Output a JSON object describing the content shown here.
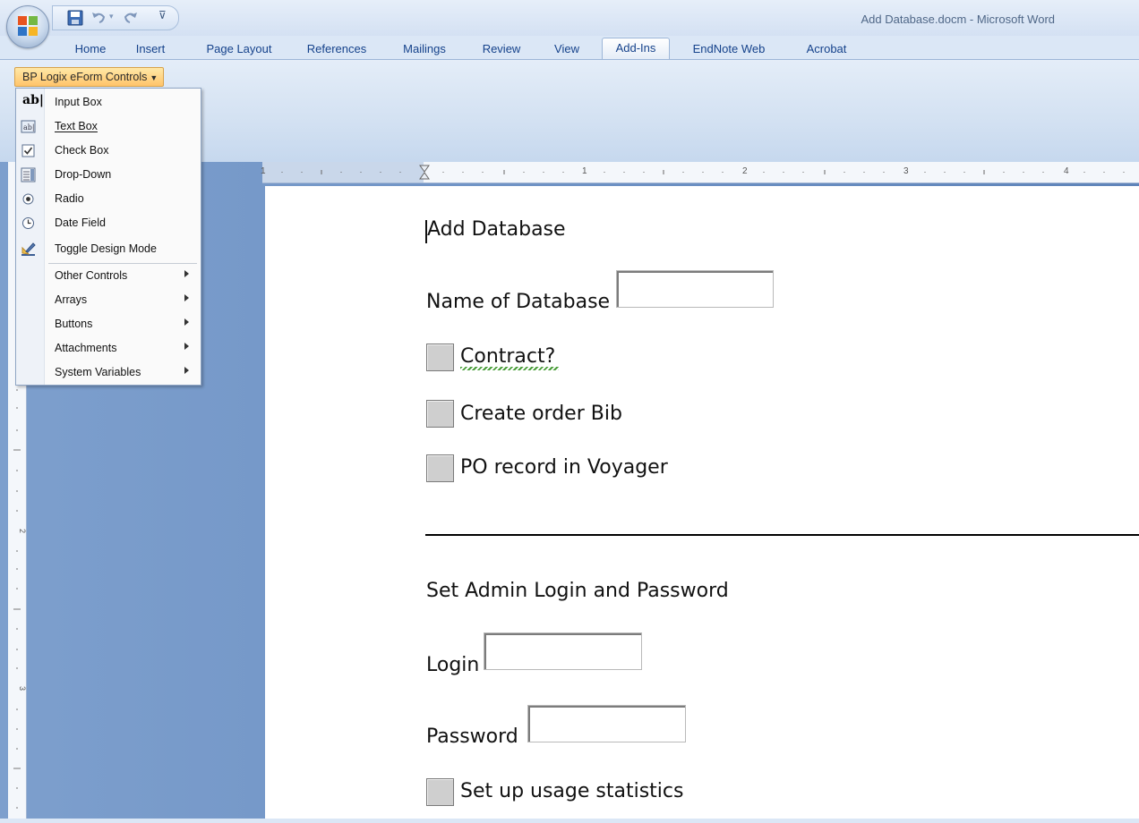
{
  "window": {
    "title": "Add Database.docm - Microsoft Word"
  },
  "quick_access": {
    "icons": [
      "office-button-icon",
      "save-icon",
      "undo-icon",
      "redo-icon",
      "customize-qat-icon"
    ]
  },
  "tabs": [
    {
      "label": "Home"
    },
    {
      "label": "Insert"
    },
    {
      "label": "Page Layout"
    },
    {
      "label": "References"
    },
    {
      "label": "Mailings"
    },
    {
      "label": "Review"
    },
    {
      "label": "View"
    },
    {
      "label": "Add-Ins",
      "active": true
    },
    {
      "label": "EndNote Web"
    },
    {
      "label": "Acrobat"
    }
  ],
  "ribbon": {
    "bp_button_label": "BP Logix eForm Controls"
  },
  "menu": {
    "items": [
      {
        "label": "Input Box",
        "icon": "input-box-icon"
      },
      {
        "label": "Text Box",
        "icon": "text-box-icon"
      },
      {
        "label": "Check Box",
        "icon": "check-box-icon"
      },
      {
        "label": "Drop-Down",
        "icon": "drop-down-icon"
      },
      {
        "label": "Radio",
        "icon": "radio-icon"
      },
      {
        "label": "Date Field",
        "icon": "date-field-icon"
      },
      {
        "label": "Toggle Design Mode",
        "icon": "design-mode-icon"
      },
      {
        "label": "Other Controls",
        "submenu": true
      },
      {
        "label": "Arrays",
        "submenu": true
      },
      {
        "label": "Buttons",
        "submenu": true
      },
      {
        "label": "Attachments",
        "submenu": true
      },
      {
        "label": "System Variables",
        "submenu": true
      }
    ]
  },
  "ruler": {
    "numbers": [
      "1",
      "1",
      "2",
      "3",
      "4"
    ]
  },
  "document": {
    "heading": "Add Database",
    "name_label": "Name of Database",
    "name_value": "",
    "checkboxes": [
      {
        "label": "Contract?",
        "checked": false
      },
      {
        "label": "Create order Bib",
        "checked": false
      },
      {
        "label": "PO record in Voyager",
        "checked": false
      }
    ],
    "admin_heading": "Set Admin Login and Password",
    "login_label": "Login",
    "login_value": "",
    "password_label": "Password",
    "password_value": "",
    "usage_label": "Set up usage statistics",
    "usage_checked": false
  }
}
